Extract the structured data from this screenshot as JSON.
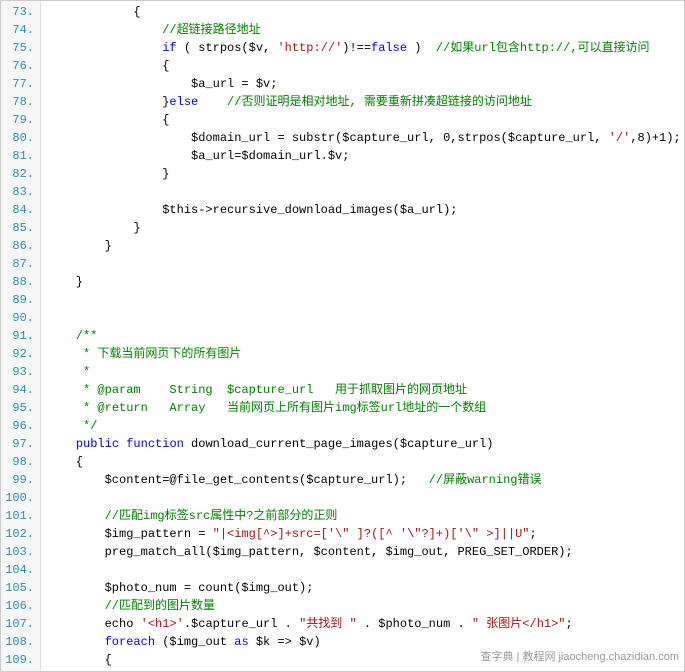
{
  "lines": {
    "start": 73,
    "end": 109
  },
  "code": {
    "l73": {
      "p1": "            {"
    },
    "l74": {
      "cm": "//超链接路径地址"
    },
    "l75": {
      "kw": "if",
      "p1": " ( strpos($v, ",
      "str": "'http://'",
      "p2": ")!==",
      "kw2": "false",
      "p3": " )  ",
      "cm": "//如果url包含http://,可以直接访问"
    },
    "l76": {
      "p1": "                {"
    },
    "l77": {
      "p1": "                    $a_url = $v;"
    },
    "l78": {
      "p1": "                }",
      "kw": "else",
      "p2": "    ",
      "cm": "//否则证明是相对地址, 需要重新拼凑超链接的访问地址"
    },
    "l79": {
      "p1": "                {"
    },
    "l80": {
      "p1": "                    $domain_url = substr($capture_url, 0,strpos($capture_url, ",
      "str": "'/'",
      "p2": ",8)+1);"
    },
    "l81": {
      "p1": "                    $a_url=$domain_url.$v;"
    },
    "l82": {
      "p1": "                }"
    },
    "l83": {
      "p1": ""
    },
    "l84": {
      "p1": "                $this->recursive_download_images($a_url);"
    },
    "l85": {
      "p1": "            }"
    },
    "l86": {
      "p1": "        }"
    },
    "l87": {
      "p1": ""
    },
    "l88": {
      "p1": "    }"
    },
    "l89": {
      "p1": ""
    },
    "l90": {
      "p1": ""
    },
    "l91": {
      "cm": "/**"
    },
    "l92": {
      "cm": " * 下载当前网页下的所有图片"
    },
    "l93": {
      "cm": " *"
    },
    "l94": {
      "cm": " * @param    String  $capture_url   用于抓取图片的网页地址"
    },
    "l95": {
      "cm": " * @return   Array   当前网页上所有图片img标签url地址的一个数组"
    },
    "l96": {
      "cm": " */"
    },
    "l97": {
      "kw": "public",
      "kw2": "function",
      "fn": " download_current_page_images($capture_url)"
    },
    "l98": {
      "p1": "    {"
    },
    "l99": {
      "p1": "        $content=@file_get_contents($capture_url);   ",
      "cm": "//屏蔽warning错误"
    },
    "l100": {
      "p1": ""
    },
    "l101": {
      "cm": "//匹配img标签src属性中?之前部分的正则"
    },
    "l102": {
      "p1": "        $img_pattern = ",
      "str": "\"|<img[^>]+src=['\\\" ]?([^ '\\\"?]+)['\\\" >]||U\"",
      "p2": ";"
    },
    "l103": {
      "p1": "        preg_match_all($img_pattern, $content, $img_out, PREG_SET_ORDER);"
    },
    "l104": {
      "p1": ""
    },
    "l105": {
      "p1": "        $photo_num = count($img_out);"
    },
    "l106": {
      "cm": "//匹配到的图片数量"
    },
    "l107": {
      "p1": "        echo ",
      "str1": "'<h1>'",
      "p2": ".$capture_url . ",
      "str2": "\"共找到 \"",
      "p3": " . $photo_num . ",
      "str3": "\" 张图片</h1>\"",
      "p4": ";"
    },
    "l108": {
      "kw": "foreach",
      "p1": " ($img_out ",
      "kw2": "as",
      "p2": " $k => $v)"
    },
    "l109": {
      "p1": "        {"
    }
  },
  "watermark": "查字典 | 教程网\njiaocheng.chazidian.com"
}
